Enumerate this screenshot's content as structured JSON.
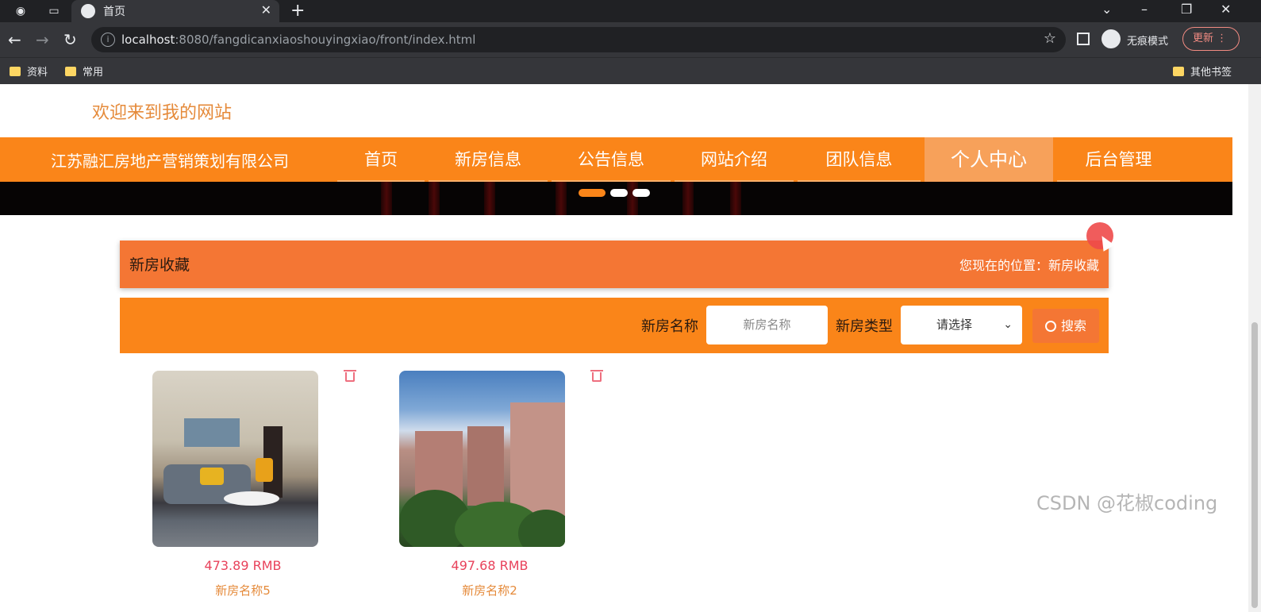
{
  "browser": {
    "tab_title": "首页",
    "url_host": "localhost",
    "url_rest": ":8080/fangdicanxiaoshouyingxiao/front/index.html",
    "incognito_label": "无痕模式",
    "update_label": "更新",
    "bookmarks": [
      "资料",
      "常用"
    ],
    "other_bookmarks": "其他书签"
  },
  "site": {
    "welcome": "欢迎来到我的网站",
    "brand": "江苏融汇房地产营销策划有限公司",
    "nav": [
      "首页",
      "新房信息",
      "公告信息",
      "网站介绍",
      "团队信息",
      "个人中心",
      "后台管理"
    ],
    "active_nav": "个人中心"
  },
  "section": {
    "title": "新房收藏",
    "location_prefix": "您现在的位置：",
    "location": "新房收藏"
  },
  "search": {
    "name_label": "新房名称",
    "name_placeholder": "新房名称",
    "type_label": "新房类型",
    "type_selected": "请选择",
    "button": "搜索"
  },
  "items": [
    {
      "price": "473.89 RMB",
      "name": "新房名称5"
    },
    {
      "price": "497.68 RMB",
      "name": "新房名称2"
    }
  ],
  "watermark": "CSDN @花椒coding"
}
